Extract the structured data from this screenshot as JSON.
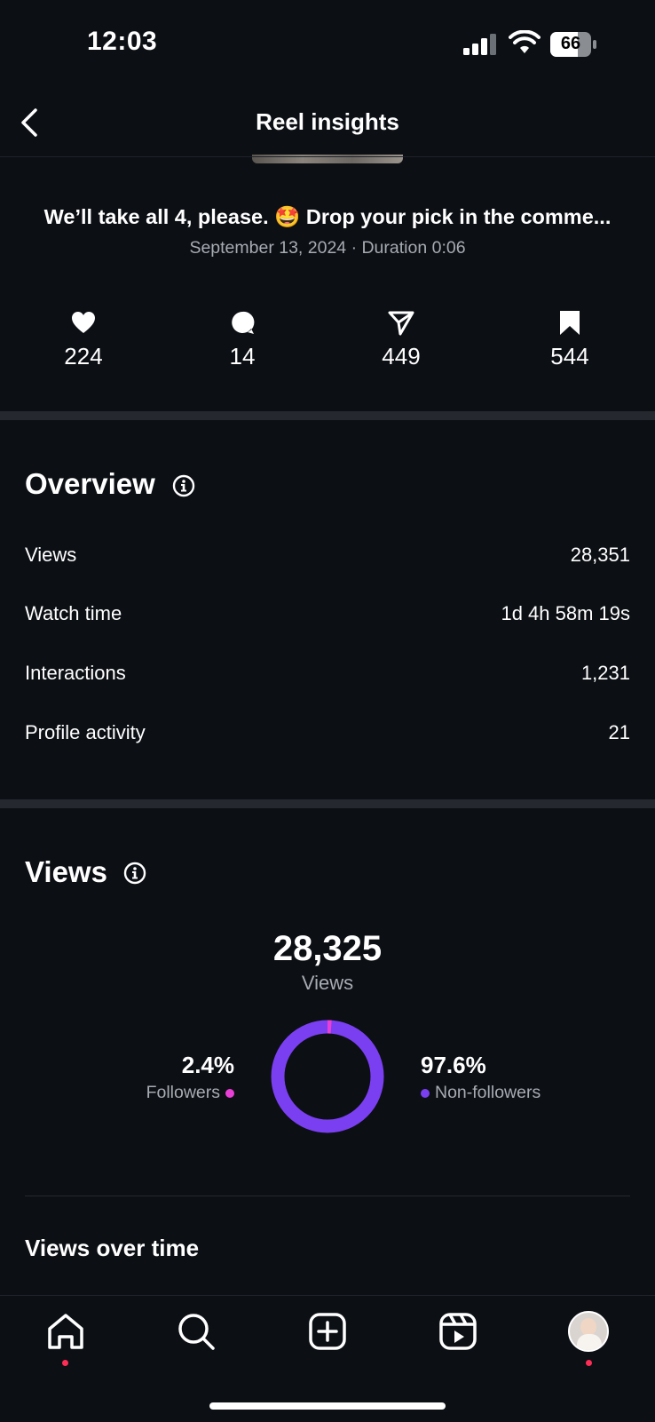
{
  "status_bar": {
    "time": "12:03",
    "battery": "66"
  },
  "header": {
    "title": "Reel insights"
  },
  "reel": {
    "caption": "We’ll take all 4, please. 🤩 Drop your pick in the comme...",
    "meta": "September 13, 2024 · Duration 0:06"
  },
  "engagement": {
    "likes": "224",
    "comments": "14",
    "shares": "449",
    "saves": "544"
  },
  "overview": {
    "title": "Overview",
    "rows": [
      {
        "label": "Views",
        "value": "28,351"
      },
      {
        "label": "Watch time",
        "value": "1d 4h 58m 19s"
      },
      {
        "label": "Interactions",
        "value": "1,231"
      },
      {
        "label": "Profile activity",
        "value": "21"
      }
    ]
  },
  "views": {
    "title": "Views",
    "total": "28,325",
    "total_label": "Views",
    "followers_pct": "2.4%",
    "followers_label": "Followers",
    "non_followers_pct": "97.6%",
    "non_followers_label": "Non-followers",
    "followers_fraction": 0.024,
    "followers_color": "#e83fd6",
    "non_followers_color": "#7b3ff2"
  },
  "views_over_time": {
    "title": "Views over time"
  },
  "bottom_nav": {
    "items": [
      "home-icon",
      "search-icon",
      "create-icon",
      "reels-icon",
      "profile-avatar"
    ]
  }
}
